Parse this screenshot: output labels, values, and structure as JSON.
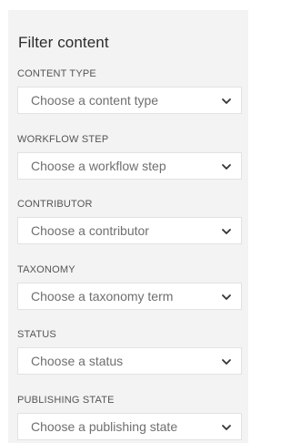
{
  "panel": {
    "title": "Filter content"
  },
  "filters": [
    {
      "label": "CONTENT TYPE",
      "placeholder": "Choose a content type",
      "icon": "chevron-down-icon"
    },
    {
      "label": "WORKFLOW STEP",
      "placeholder": "Choose a workflow step",
      "icon": "chevron-down-icon"
    },
    {
      "label": "CONTRIBUTOR",
      "placeholder": "Choose a contributor",
      "icon": "chevron-down-icon"
    },
    {
      "label": "TAXONOMY",
      "placeholder": "Choose a taxonomy term",
      "icon": "chevron-down-icon"
    },
    {
      "label": "STATUS",
      "placeholder": "Choose a status",
      "icon": "chevron-down-icon"
    },
    {
      "label": "PUBLISHING STATE",
      "placeholder": "Choose a publishing state",
      "icon": "chevron-down-icon"
    }
  ],
  "colors": {
    "panel_background": "#f3f3f3",
    "select_background": "#ffffff",
    "select_border": "#e2e2e2",
    "label_text": "#555555",
    "placeholder_text": "#6f6f6f"
  }
}
